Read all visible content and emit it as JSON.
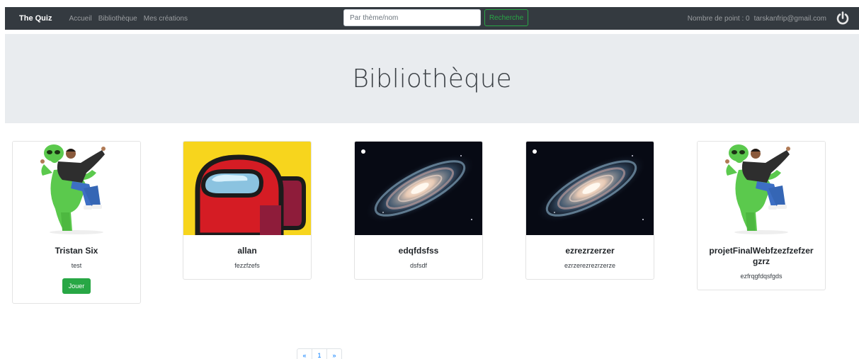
{
  "navbar": {
    "brand": "The Quiz",
    "links": [
      "Accueil",
      "Bibliothèque",
      "Mes créations"
    ],
    "search_placeholder": "Par thème/nom",
    "search_button": "Recherche",
    "points": "Nombre de point : 0",
    "email": "tarskanfrip@gmail.com",
    "power_icon": "power-icon"
  },
  "page": {
    "title": "Bibliothèque"
  },
  "cards": [
    {
      "title": "Tristan Six",
      "description": "test",
      "image": "alien-costume",
      "button": "Jouer"
    },
    {
      "title": "allan",
      "description": "fezzfzefs",
      "image": "among-us-crewmate"
    },
    {
      "title": "edqfdsfss",
      "description": "dsfsdf",
      "image": "spiral-galaxy"
    },
    {
      "title": "ezrezrzerzer",
      "description": "ezrzerezrezrzerze",
      "image": "spiral-galaxy"
    },
    {
      "title": "projetFinalWebfzezfzefzer gzrz",
      "description": "ezfrqgfdqsfgds",
      "image": "alien-costume"
    }
  ],
  "pagination": {
    "prev": "«",
    "pages": [
      "1"
    ],
    "next": "»"
  },
  "colors": {
    "navbar_bg": "#343a40",
    "jumbotron_bg": "#e9ecef",
    "success": "#28a745",
    "link": "#007bff"
  }
}
